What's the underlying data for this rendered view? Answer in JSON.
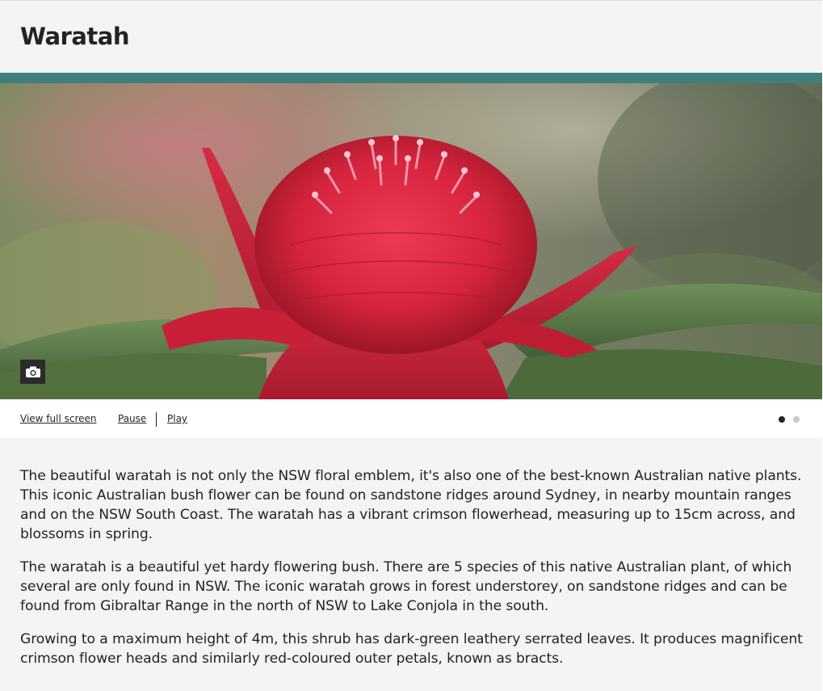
{
  "page": {
    "title": "Waratah"
  },
  "hero": {
    "image_alt": "Red waratah flower in bloom",
    "camera_icon": "camera-icon"
  },
  "gallery_controls": {
    "view_full_screen": "View full screen",
    "pause": "Pause",
    "play": "Play",
    "slide_count": 2,
    "active_slide": 1
  },
  "content": {
    "paragraphs": [
      "The beautiful waratah is not only the NSW floral emblem, it's also one of the best-known Australian native plants. This iconic Australian bush flower can be found on sandstone ridges around Sydney, in nearby mountain ranges and on the NSW South Coast. The waratah has a vibrant crimson flowerhead, measuring up to 15cm across, and blossoms in spring.",
      "The waratah is a beautiful yet hardy flowering bush. There are 5 species of this native Australian plant, of which several are only found in NSW. The iconic waratah grows in forest understorey, on sandstone ridges and can be found from Gibraltar Range in the north of NSW to Lake Conjola in the south.",
      "Growing to a maximum height of 4m, this shrub has dark-green leathery serrated leaves. It produces magnificent crimson flower heads and similarly red-coloured outer petals, known as bracts."
    ]
  },
  "colors": {
    "accent_band": "#3f7f7d",
    "flower": "#d8253f",
    "text": "#232323",
    "dot_active": "#232323",
    "dot_inactive": "#c8c8c8"
  }
}
